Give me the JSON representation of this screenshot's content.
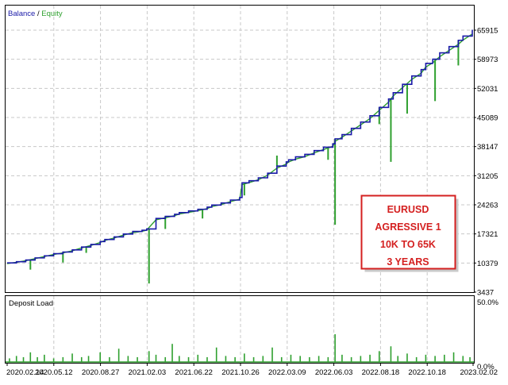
{
  "colors": {
    "balance": "#1a1aa8",
    "equity": "#2fa02f",
    "deposit_load": "#2fa02f",
    "grid": "#c8c8c8",
    "frame": "#000000",
    "annotation": "#d42020"
  },
  "chart_data": [
    {
      "type": "line",
      "legend": {
        "balance_label": "Balance",
        "separator": " / ",
        "equity_label": "Equity",
        "placement": "top-left"
      },
      "ylim": [
        3437,
        68000
      ],
      "y_ticks": [
        "65915",
        "58973",
        "52031",
        "45089",
        "38147",
        "31205",
        "24263",
        "17321",
        "10379",
        "3437"
      ],
      "x_ticks": [
        "2020.02.14",
        "2020.05.12",
        "2020.08.27",
        "2021.02.03",
        "2021.06.22",
        "2021.10.26",
        "2022.03.09",
        "2022.06.03",
        "2022.08.18",
        "2022.10.18",
        "2023.02.02"
      ],
      "grid": true,
      "series": [
        {
          "name": "Balance",
          "x": [
            0,
            2,
            4,
            6,
            8,
            10,
            12,
            14,
            16,
            18,
            20,
            21,
            23,
            25,
            27,
            29,
            30,
            32,
            34,
            36,
            37,
            39,
            41,
            43,
            44,
            46,
            48,
            50,
            50.5,
            52,
            54,
            56,
            58,
            60,
            60.5,
            62,
            64,
            66,
            68,
            70,
            70.5,
            72,
            74,
            76,
            78,
            80,
            82,
            83,
            85,
            87,
            89,
            90,
            91.5,
            93,
            95,
            97,
            98,
            100
          ],
          "y": [
            10400,
            10700,
            11100,
            11600,
            12100,
            12600,
            13000,
            13500,
            14200,
            14800,
            15500,
            16000,
            16600,
            17300,
            17900,
            18200,
            18500,
            21000,
            21500,
            22000,
            22400,
            22800,
            23200,
            23700,
            24200,
            24700,
            25400,
            26000,
            29500,
            30000,
            30700,
            31800,
            33500,
            34500,
            35000,
            35700,
            36300,
            37200,
            38000,
            38800,
            40000,
            41000,
            42500,
            44000,
            45500,
            47500,
            49500,
            51000,
            53000,
            55000,
            56500,
            58000,
            59000,
            60500,
            62000,
            63500,
            64500,
            66000
          ]
        },
        {
          "name": "Equity",
          "spikes": [
            {
              "x": 5,
              "y": 8800
            },
            {
              "x": 12,
              "y": 10500
            },
            {
              "x": 17,
              "y": 12800
            },
            {
              "x": 30.5,
              "y": 5500
            },
            {
              "x": 34,
              "y": 18500
            },
            {
              "x": 42,
              "y": 21000
            },
            {
              "x": 51,
              "y": 26500
            },
            {
              "x": 58,
              "y": 36000
            },
            {
              "x": 69,
              "y": 35000
            },
            {
              "x": 70.5,
              "y": 19500
            },
            {
              "x": 80,
              "y": 43500
            },
            {
              "x": 82.5,
              "y": 34500
            },
            {
              "x": 86,
              "y": 46000
            },
            {
              "x": 92,
              "y": 49000
            },
            {
              "x": 97,
              "y": 57500
            }
          ]
        }
      ],
      "annotation": [
        "EURUSD",
        "AGRESSIVE 1",
        "10K TO 65K",
        "3 YEARS"
      ]
    },
    {
      "type": "bar",
      "title": "Deposit Load",
      "ylim": [
        0,
        50
      ],
      "y_ticks": [
        "50.0%",
        "0.0%"
      ],
      "series": [
        {
          "name": "Deposit Load",
          "x": [
            0.5,
            2,
            3.5,
            5,
            6.5,
            8,
            10,
            12,
            14,
            16,
            17.5,
            20,
            22,
            24,
            26,
            28,
            30.5,
            32,
            34,
            35.5,
            37,
            39,
            41,
            43,
            45,
            47,
            49,
            51,
            53,
            55,
            57,
            59,
            61,
            63,
            65,
            67,
            69,
            70.5,
            72,
            74,
            76,
            78,
            80,
            82.5,
            84,
            86,
            88,
            90,
            92,
            94,
            96,
            98,
            99.5
          ],
          "y": [
            3,
            5,
            4,
            8,
            4,
            6,
            3,
            4,
            7,
            4,
            5,
            8,
            4,
            11,
            5,
            4,
            9,
            6,
            4,
            15,
            5,
            4,
            6,
            4,
            12,
            5,
            4,
            7,
            4,
            5,
            12,
            4,
            6,
            5,
            4,
            5,
            4,
            23,
            6,
            4,
            5,
            6,
            9,
            13,
            5,
            7,
            4,
            6,
            5,
            6,
            8,
            5,
            4
          ]
        }
      ]
    }
  ]
}
